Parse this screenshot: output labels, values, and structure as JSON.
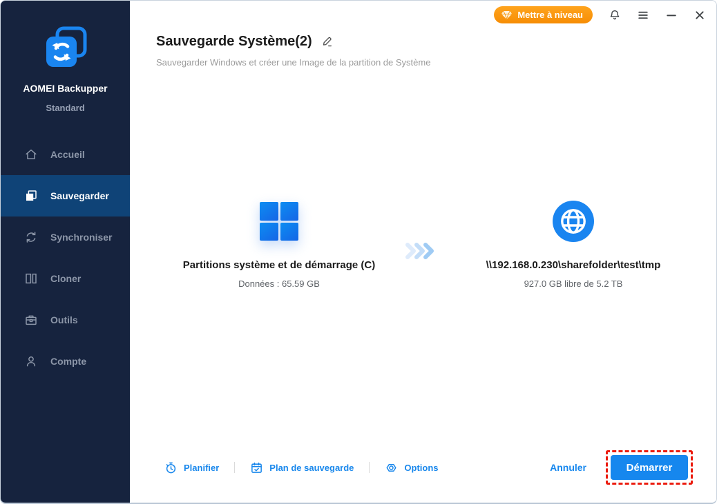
{
  "topbar": {
    "upgrade_label": "Mettre à niveau"
  },
  "sidebar": {
    "brand": {
      "name": "AOMEI Backupper",
      "edition": "Standard"
    },
    "items": [
      {
        "label": "Accueil",
        "icon": "home-icon",
        "active": false
      },
      {
        "label": "Sauvegarder",
        "icon": "backup-icon",
        "active": true
      },
      {
        "label": "Synchroniser",
        "icon": "sync-icon",
        "active": false
      },
      {
        "label": "Cloner",
        "icon": "clone-icon",
        "active": false
      },
      {
        "label": "Outils",
        "icon": "toolbox-icon",
        "active": false
      },
      {
        "label": "Compte",
        "icon": "account-icon",
        "active": false
      }
    ]
  },
  "header": {
    "title": "Sauvegarde Système(2)",
    "subtitle": "Sauvegarder Windows et créer une Image de la partition de Système"
  },
  "main": {
    "source": {
      "icon": "windows-logo-icon",
      "name": "Partitions système et de démarrage (C)",
      "detail": "Données : 65.59 GB"
    },
    "destination": {
      "icon": "network-globe-icon",
      "name": "\\\\192.168.0.230\\sharefolder\\test\\tmp",
      "detail": "927.0 GB libre de 5.2 TB"
    }
  },
  "footer": {
    "links": [
      {
        "label": "Planifier",
        "icon": "stopwatch-icon"
      },
      {
        "label": "Plan de sauvegarde",
        "icon": "calendar-check-icon"
      },
      {
        "label": "Options",
        "icon": "options-hex-icon"
      }
    ],
    "cancel_label": "Annuler",
    "start_label": "Démarrer"
  },
  "colors": {
    "accent_blue": "#1687EE",
    "brand_blue": "#1A85F0",
    "sidebar_bg": "#16233E",
    "sidebar_active_bg": "#0F4377",
    "upgrade_orange": "#F68D05",
    "highlight_red": "#EB1B0E"
  }
}
